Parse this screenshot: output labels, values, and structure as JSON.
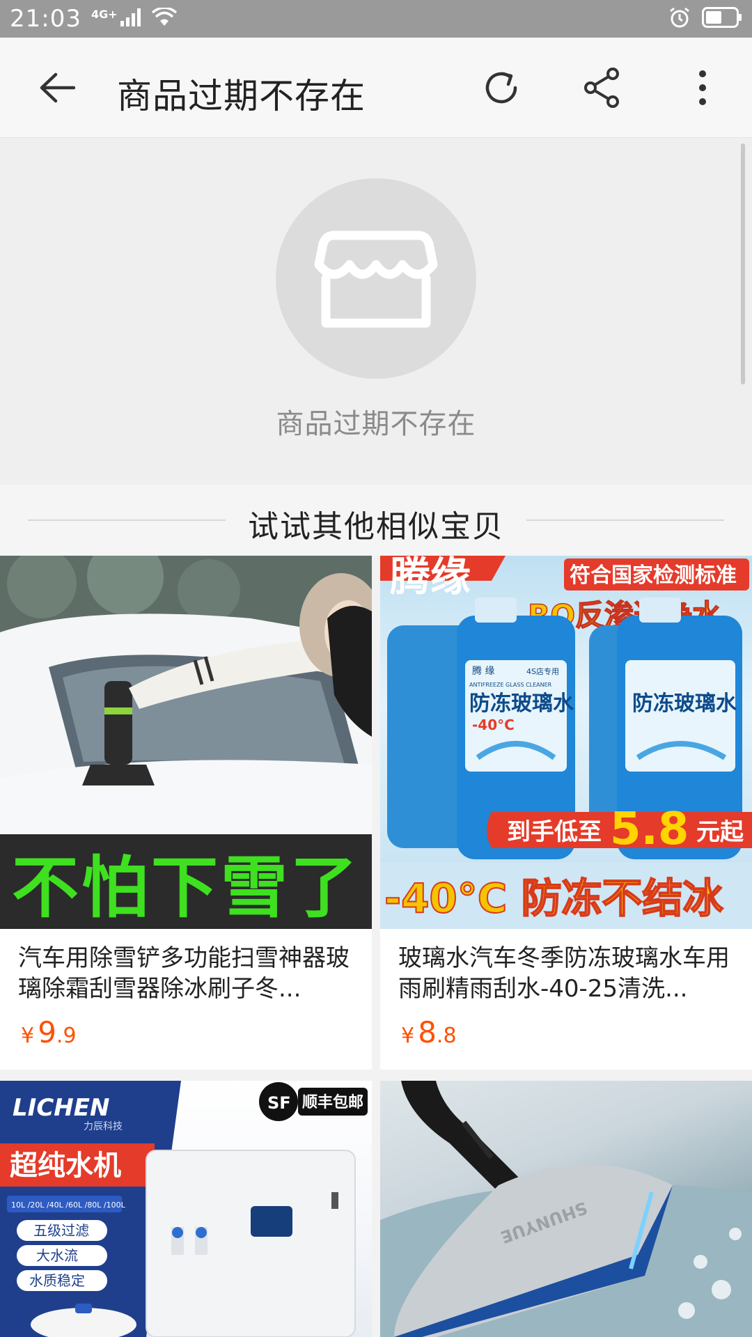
{
  "status_bar": {
    "time": "21:03",
    "network": "4G+"
  },
  "header": {
    "title": "商品过期不存在",
    "back_icon": "arrow-left-icon",
    "refresh_icon": "refresh-icon",
    "share_icon": "share-icon",
    "more_icon": "more-vertical-icon"
  },
  "empty_state": {
    "icon": "store-icon",
    "message": "商品过期不存在"
  },
  "recommend": {
    "title": "试试其他相似宝贝",
    "products": [
      {
        "title": "汽车用除雪铲多功能扫雪神器玻璃除霜刮雪器除冰刷子冬...",
        "price_symbol": "¥",
        "price_int": "9",
        "price_dec": ".9",
        "banner": "不怕下雪了"
      },
      {
        "title": "玻璃水汽车冬季防冻玻璃水车用雨刷精雨刮水-40-25清洗...",
        "price_symbol": "¥",
        "price_int": "8",
        "price_dec": ".8",
        "brand": "腾缘",
        "badge": "符合国家检测标准",
        "headline": "RO反渗透净水",
        "bottle_label_brand": "腾 缘",
        "bottle_label_sub": "ANTIFREEZE GLASS CLEANER",
        "bottle_label_name": "防冻玻璃水",
        "bottle_label_temp": "-40°C",
        "bottle_label_shop": "4S店专用",
        "promo_prefix": "到手低至",
        "promo_price": "5.8",
        "promo_suffix": "元起",
        "bottom_text": "-40°C 防冻不结冰"
      },
      {
        "brand": "LICHEN",
        "brand_sub": "力辰科技",
        "badge": "顺丰包邮",
        "badge_logo": "SF",
        "headline": "超纯水机",
        "capacities": "10L /20L /40L /60L /80L /100L",
        "features": [
          "五级过滤",
          "大水流",
          "水质稳定"
        ]
      },
      {
        "brand_mark": "SHUNYUE"
      }
    ]
  },
  "colors": {
    "price": "#ff5000",
    "header_bg": "#f7f7f7",
    "status_bg": "#9a9a9a"
  }
}
